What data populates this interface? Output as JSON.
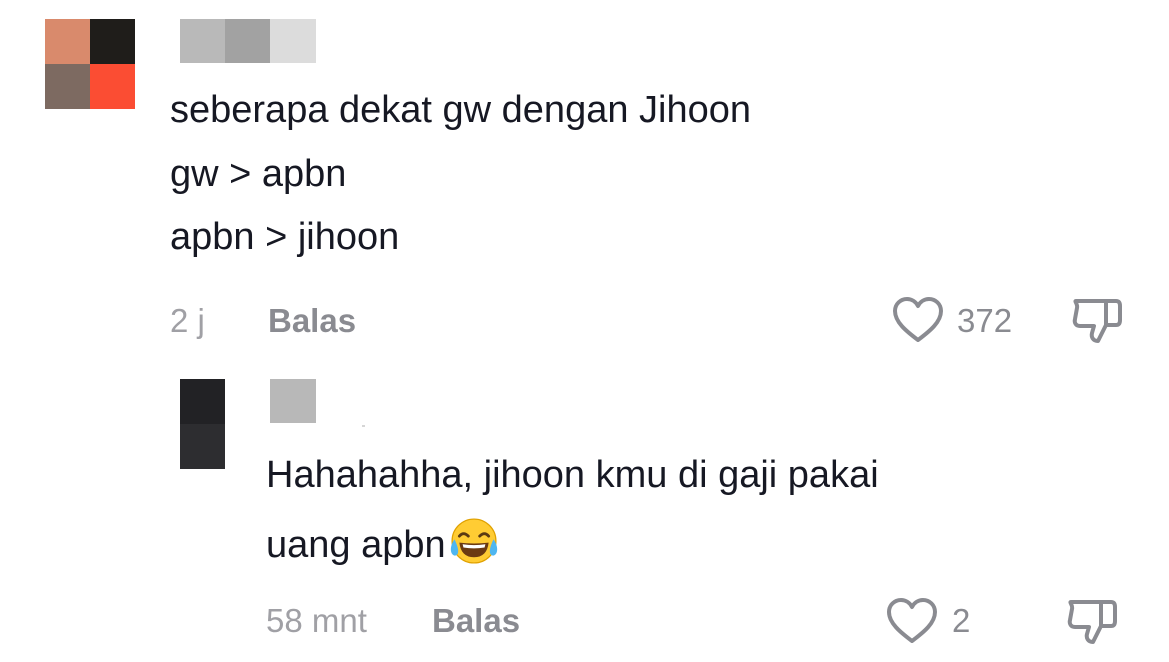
{
  "comments": [
    {
      "avatar_colors": [
        "#d98a6c",
        "#1f1d1a",
        "#7d6a61",
        "#fb4d33"
      ],
      "username_blocks": [
        "#b9b9b9",
        "#a2a2a2",
        "#dcdcdc"
      ],
      "text_lines": [
        "seberapa dekat gw dengan Jihoon",
        "gw > apbn",
        "apbn > jihoon"
      ],
      "time": "2 j",
      "reply_label": "Balas",
      "like_count": "372",
      "like_icon": "heart-outline-icon",
      "dislike_icon": "thumbs-down-icon"
    },
    {
      "avatar_colors": [
        "#222225",
        "#2d2d30"
      ],
      "username_blocks": [
        "#b8b8b8"
      ],
      "text_lines": [
        "Hahahahha, jihoon kmu di gaji pakai",
        "uang apbn"
      ],
      "emoji": "face-with-tears-of-joy",
      "time": "58 mnt",
      "reply_label": "Balas",
      "like_count": "2",
      "like_icon": "heart-outline-icon",
      "dislike_icon": "thumbs-down-icon"
    }
  ]
}
